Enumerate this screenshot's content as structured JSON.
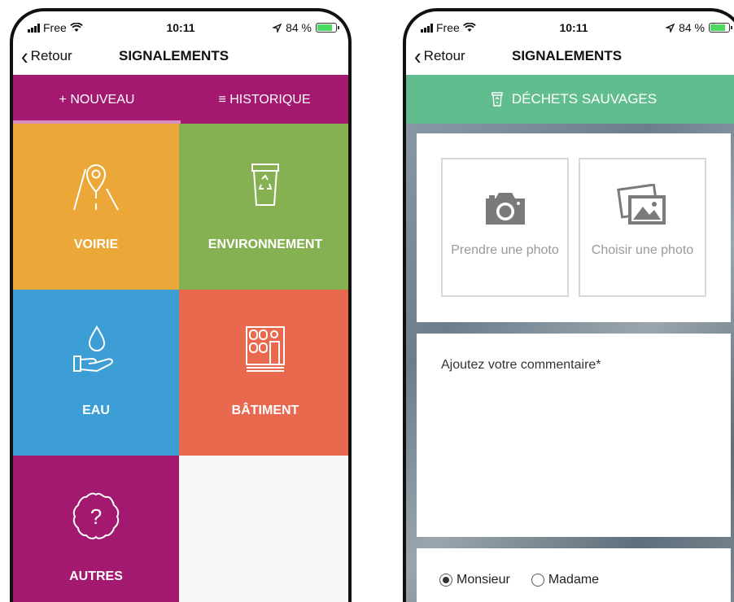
{
  "status": {
    "carrier": "Free",
    "time": "10:11",
    "battery": "84 %"
  },
  "nav": {
    "back_label": "Retour",
    "title": "SIGNALEMENTS"
  },
  "tabs": {
    "new_label": "+ NOUVEAU",
    "history_label": "≡ HISTORIQUE"
  },
  "categories": [
    {
      "label": "VOIRIE",
      "icon": "road-pin-icon",
      "color": "#eba838"
    },
    {
      "label": "ENVIRONNEMENT",
      "icon": "recycle-bin-icon",
      "color": "#86b153"
    },
    {
      "label": "EAU",
      "icon": "water-hand-icon",
      "color": "#3d9ed5"
    },
    {
      "label": "BÂTIMENT",
      "icon": "building-icon",
      "color": "#e9694f"
    },
    {
      "label": "AUTRES",
      "icon": "question-icon",
      "color": "#a3196f"
    }
  ],
  "form": {
    "category_title": "DÉCHETS SAUVAGES",
    "take_photo": "Prendre une photo",
    "choose_photo": "Choisir une photo",
    "comment_placeholder": "Ajoutez votre commentaire*",
    "gender_options": [
      "Monsieur",
      "Madame"
    ],
    "gender_selected": "Monsieur"
  },
  "colors": {
    "accent": "#a3196f",
    "banner": "#62bd8e"
  }
}
